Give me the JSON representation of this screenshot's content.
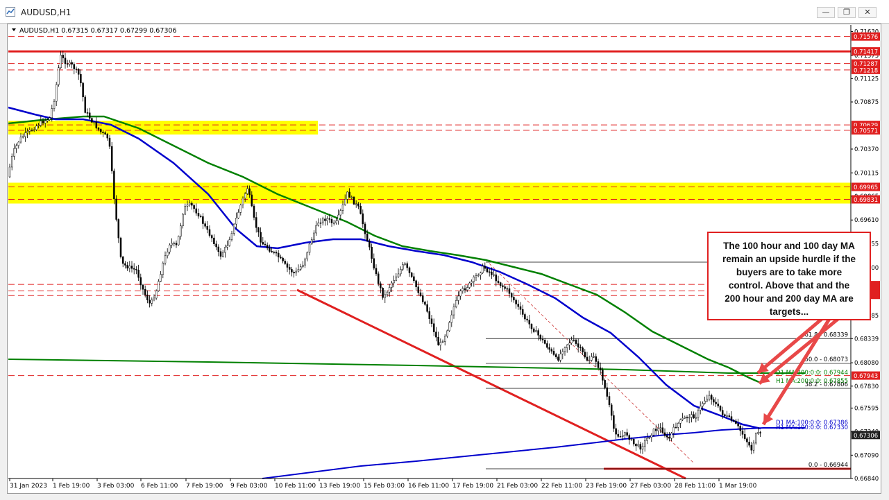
{
  "window": {
    "title": "AUDUSD,H1",
    "buttons": {
      "minimize": "—",
      "restore": "❐",
      "close": "✕"
    }
  },
  "chart_info": "AUDUSD,H1  0.67315 0.67317 0.67299 0.67306",
  "callout": {
    "lines": [
      "The 100 hour and 100 day MA",
      "remain an upside hurdle if the",
      "buyers are to take more",
      "control.  Above that and the",
      "200 hour and 200 day MA are",
      "targets..."
    ]
  },
  "chart_data": {
    "type": "line",
    "symbol": "AUDUSD",
    "timeframe": "H1",
    "ohlc_header": [
      0.67315,
      0.67317,
      0.67299,
      0.67306
    ],
    "last_price": 0.67306,
    "ylim": [
      0.6684,
      0.717
    ],
    "y_ticks": [
      0.7163,
      0.71373,
      0.71125,
      0.70875,
      0.7037,
      0.70115,
      0.69865,
      0.6961,
      0.69355,
      0.691,
      0.68845,
      0.68585,
      0.68339,
      0.6808,
      0.6783,
      0.67595,
      0.6734,
      0.6709,
      0.6684
    ],
    "x_tick_labels": [
      "31 Jan 2023",
      "1 Feb 19:00",
      "3 Feb 03:00",
      "6 Feb 11:00",
      "7 Feb 19:00",
      "9 Feb 03:00",
      "10 Feb 11:00",
      "13 Feb 19:00",
      "15 Feb 03:00",
      "16 Feb 11:00",
      "17 Feb 19:00",
      "21 Feb 03:00",
      "22 Feb 11:00",
      "23 Feb 19:00",
      "27 Feb 03:00",
      "28 Feb 11:00",
      "1 Mar 19:00"
    ],
    "price_levels": [
      {
        "label": "0.71576",
        "value": 0.71576,
        "style": "dashed"
      },
      {
        "label": "0.71417",
        "value": 0.71417,
        "style": "solid"
      },
      {
        "label": "0.71287",
        "value": 0.71287,
        "style": "dashed"
      },
      {
        "label": "0.71218",
        "value": 0.71218,
        "style": "dashed"
      },
      {
        "label": "0.70629",
        "value": 0.70629,
        "style": "dashed"
      },
      {
        "label": "0.70571",
        "value": 0.70571,
        "style": "dashed"
      },
      {
        "label": "0.69965",
        "value": 0.69965,
        "style": "dashed"
      },
      {
        "label": "0.69831",
        "value": 0.69831,
        "style": "dashed"
      },
      {
        "label": "0.67943",
        "value": 0.67943,
        "style": "dashed"
      },
      {
        "label": "0.67306",
        "value": 0.67306,
        "style": "current"
      }
    ],
    "zones": [
      {
        "from": 0.70571,
        "to": 0.70629,
        "color": "#ffff00"
      },
      {
        "from": 0.69831,
        "to": 0.69965,
        "color": "#ffff00"
      }
    ],
    "fib_levels": [
      {
        "label": "61.8 - 0.68339",
        "value": 0.68339
      },
      {
        "label": "50.0 - 0.68073",
        "value": 0.68073
      },
      {
        "label": "38.2 - 0.67806",
        "value": 0.67806
      },
      {
        "label": "0.0 - 0.66944",
        "value": 0.66944
      }
    ],
    "ma_labels": [
      {
        "label": "D1 MA:200:0:0: 0.67944",
        "value": 0.67944,
        "color": "#008000"
      },
      {
        "label": "H1 MA:200:0:0: 0.67855",
        "value": 0.67855,
        "color": "#008000"
      },
      {
        "label": "D1 MA:100:0:0: 0.67386",
        "value": 0.67386,
        "color": "#0000cc"
      },
      {
        "label": "H1 MA:100:0:0: 0.67330",
        "value": 0.6733,
        "color": "#0000cc"
      }
    ],
    "colors": {
      "background": "#ffffff",
      "candles": "#000000",
      "ma100": "#0000cc",
      "ma200": "#008000",
      "levels": "#e02020",
      "zones": "#ffff00",
      "price_tag": "#e02020"
    }
  }
}
